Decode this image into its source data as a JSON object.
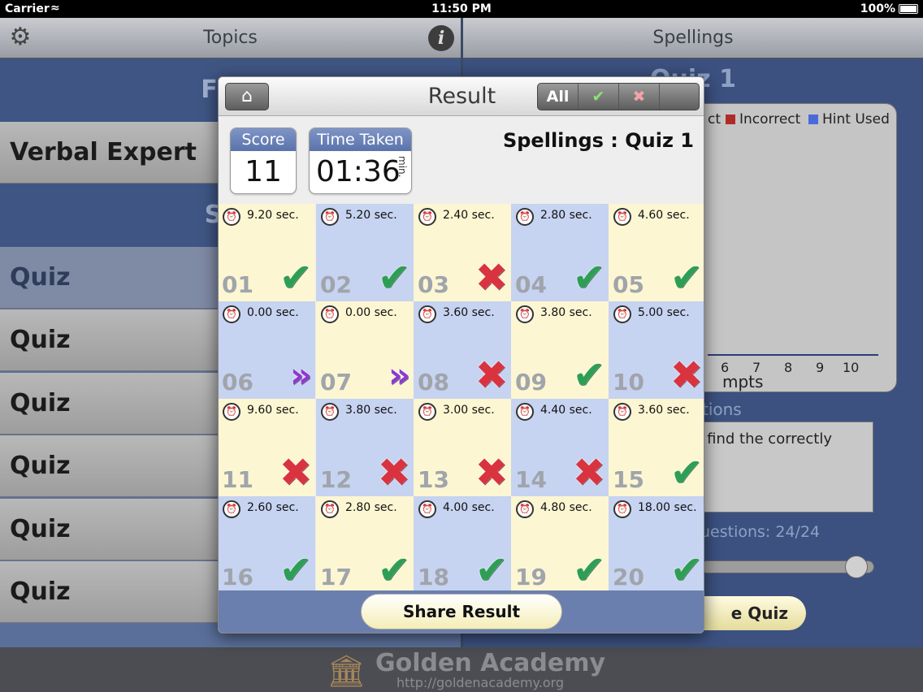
{
  "status_bar": {
    "carrier": "Carrier",
    "time": "11:50 PM",
    "battery": "100%"
  },
  "left_pane": {
    "title": "Topics",
    "sections": [
      "Fina",
      "Spe"
    ],
    "rows": [
      "Verbal Expert",
      "Quiz",
      "Quiz",
      "Quiz",
      "Quiz",
      "Quiz",
      "Quiz"
    ]
  },
  "right_pane": {
    "title": "Spellings",
    "quiz_title": "Quiz 1",
    "legend": [
      {
        "label": "ct",
        "color": ""
      },
      {
        "label": "Incorrect",
        "color": "#b12a2a"
      },
      {
        "label": "Hint Used",
        "color": "#4a6ad8"
      }
    ],
    "axis_ticks": [
      "6",
      "7",
      "8",
      "9",
      "10"
    ],
    "axis_label": "mpts",
    "questions_heading": "tions",
    "question_text": "d find the correctly",
    "questions_count": "uestions: 24/24",
    "resume_label": "e Quiz"
  },
  "footer": {
    "name": "Golden Academy",
    "url": "http://goldenacademy.org"
  },
  "popup": {
    "title": "Result",
    "filters": [
      "All",
      "✔",
      "✖",
      "»"
    ],
    "score_label": "Score",
    "score": "11",
    "time_label": "Time Taken",
    "time_value": "01:36",
    "time_unit": "min.",
    "quiz_name": "Spellings : Quiz 1",
    "share_label": "Share Result",
    "questions": [
      {
        "num": "01",
        "time": "9.20 sec.",
        "result": "correct"
      },
      {
        "num": "02",
        "time": "5.20 sec.",
        "result": "correct"
      },
      {
        "num": "03",
        "time": "2.40 sec.",
        "result": "incorrect"
      },
      {
        "num": "04",
        "time": "2.80 sec.",
        "result": "correct"
      },
      {
        "num": "05",
        "time": "4.60 sec.",
        "result": "correct"
      },
      {
        "num": "06",
        "time": "0.00 sec.",
        "result": "hint"
      },
      {
        "num": "07",
        "time": "0.00 sec.",
        "result": "hint"
      },
      {
        "num": "08",
        "time": "3.60 sec.",
        "result": "incorrect"
      },
      {
        "num": "09",
        "time": "3.80 sec.",
        "result": "correct"
      },
      {
        "num": "10",
        "time": "5.00 sec.",
        "result": "incorrect"
      },
      {
        "num": "11",
        "time": "9.60 sec.",
        "result": "incorrect"
      },
      {
        "num": "12",
        "time": "3.80 sec.",
        "result": "incorrect"
      },
      {
        "num": "13",
        "time": "3.00 sec.",
        "result": "incorrect"
      },
      {
        "num": "14",
        "time": "4.40 sec.",
        "result": "incorrect"
      },
      {
        "num": "15",
        "time": "3.60 sec.",
        "result": "correct"
      },
      {
        "num": "16",
        "time": "2.60 sec.",
        "result": "correct"
      },
      {
        "num": "17",
        "time": "2.80 sec.",
        "result": "correct"
      },
      {
        "num": "18",
        "time": "4.00 sec.",
        "result": "correct"
      },
      {
        "num": "19",
        "time": "4.80 sec.",
        "result": "correct"
      },
      {
        "num": "20",
        "time": "18.00 sec.",
        "result": "correct"
      }
    ]
  },
  "colors": {
    "correct": "#2e9e54",
    "incorrect": "#d8333f",
    "hint": "#8b39cf",
    "cell_yellow": "#fcf6d2",
    "cell_blue": "#c6d3f1"
  }
}
